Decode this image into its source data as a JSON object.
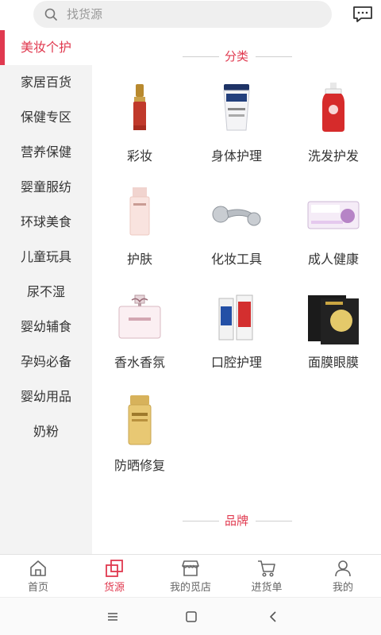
{
  "search": {
    "placeholder": "找货源"
  },
  "sidebar": {
    "items": [
      {
        "label": "美妆个护",
        "active": true
      },
      {
        "label": "家居百货"
      },
      {
        "label": "保健专区"
      },
      {
        "label": "营养保健"
      },
      {
        "label": "婴童服纺"
      },
      {
        "label": "环球美食"
      },
      {
        "label": "儿童玩具"
      },
      {
        "label": "尿不湿"
      },
      {
        "label": "婴幼辅食"
      },
      {
        "label": "孕妈必备"
      },
      {
        "label": "婴幼用品"
      },
      {
        "label": "奶粉"
      }
    ]
  },
  "sections": {
    "category_title": "分类",
    "brand_title": "品牌"
  },
  "categories": [
    {
      "label": "彩妆"
    },
    {
      "label": "身体护理"
    },
    {
      "label": "洗发护发"
    },
    {
      "label": "护肤"
    },
    {
      "label": "化妆工具"
    },
    {
      "label": "成人健康"
    },
    {
      "label": "香水香氛"
    },
    {
      "label": "口腔护理"
    },
    {
      "label": "面膜眼膜"
    },
    {
      "label": "防晒修复"
    }
  ],
  "tabbar": {
    "tabs": [
      {
        "label": "首页",
        "icon": "home-icon"
      },
      {
        "label": "货源",
        "icon": "source-icon",
        "active": true
      },
      {
        "label": "我的觅店",
        "icon": "store-icon"
      },
      {
        "label": "进货单",
        "icon": "cart-icon"
      },
      {
        "label": "我的",
        "icon": "profile-icon"
      }
    ]
  },
  "colors": {
    "accent": "#e0394f",
    "sidebar_bg": "#f3f3f3"
  }
}
